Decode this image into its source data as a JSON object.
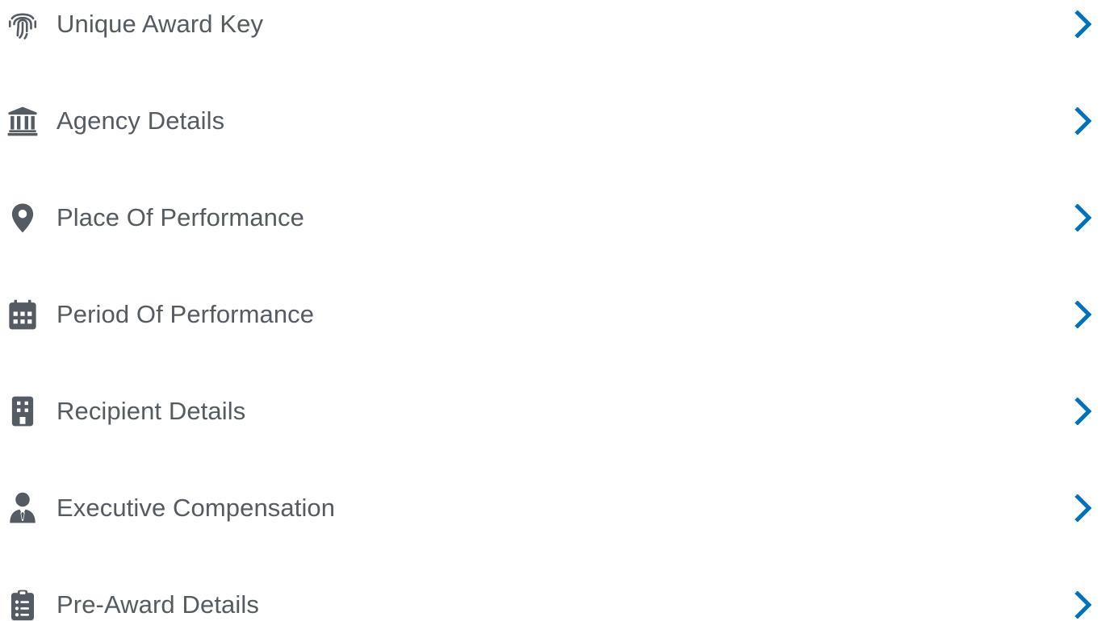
{
  "colors": {
    "icon": "#555b62",
    "text": "#555b62",
    "chevron": "#0071bc",
    "background": "#ffffff"
  },
  "menu": {
    "items": [
      {
        "label": "Unique Award Key",
        "icon": "fingerprint-icon"
      },
      {
        "label": "Agency Details",
        "icon": "landmark-icon"
      },
      {
        "label": "Place Of Performance",
        "icon": "map-marker-icon"
      },
      {
        "label": "Period Of Performance",
        "icon": "calendar-icon"
      },
      {
        "label": "Recipient Details",
        "icon": "building-icon"
      },
      {
        "label": "Executive Compensation",
        "icon": "user-tie-icon"
      },
      {
        "label": "Pre-Award Details",
        "icon": "clipboard-list-icon"
      }
    ]
  }
}
